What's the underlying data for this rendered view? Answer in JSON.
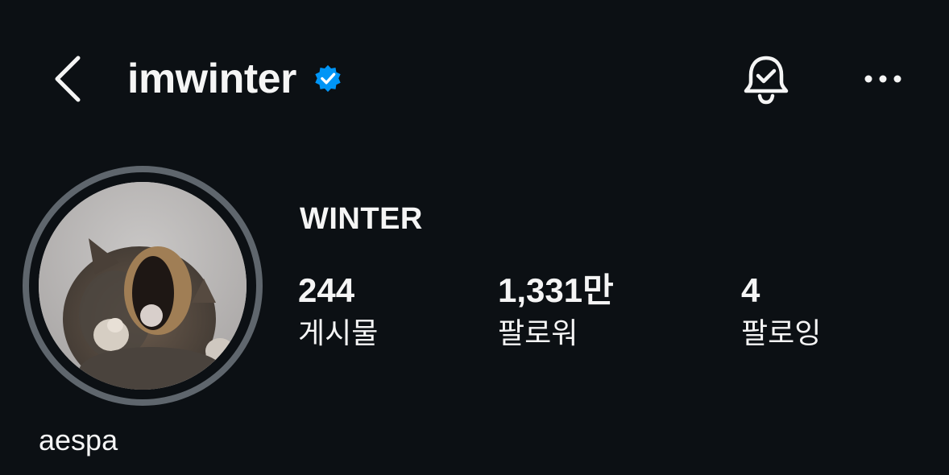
{
  "header": {
    "username": "imwinter",
    "verified_icon": "verified-badge-icon",
    "back_icon": "chevron-left-icon",
    "notification_icon": "bell-check-icon",
    "more_icon": "more-horizontal-icon",
    "verified_color": "#0095f6"
  },
  "profile": {
    "display_name": "WINTER",
    "avatar_ring_color": "#5f666d",
    "bio": "aespa"
  },
  "stats": {
    "posts": {
      "value": "244",
      "label": "게시물"
    },
    "followers": {
      "value": "1,331만",
      "label": "팔로워"
    },
    "following": {
      "value": "4",
      "label": "팔로잉"
    }
  },
  "theme": {
    "background": "#0c1014",
    "text": "#f5f5f5"
  }
}
